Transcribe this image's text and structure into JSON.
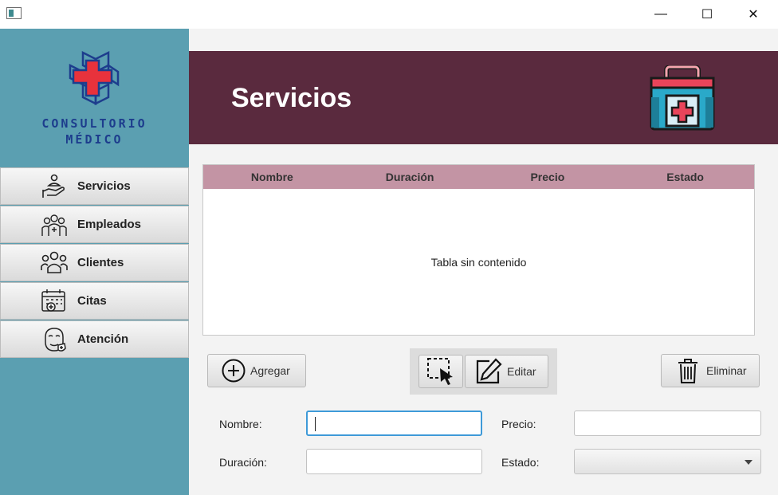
{
  "window": {
    "minimize_glyph": "—",
    "maximize_glyph": "☐",
    "close_glyph": "✕"
  },
  "brand": {
    "line1": "CONSULTORIO",
    "line2": "MÉDICO",
    "logo_icon": "medical-cross-cube-icon"
  },
  "sidebar": {
    "items": [
      {
        "label": "Servicios",
        "icon": "hand-service-icon"
      },
      {
        "label": "Empleados",
        "icon": "staff-group-icon"
      },
      {
        "label": "Clientes",
        "icon": "people-icon"
      },
      {
        "label": "Citas",
        "icon": "calendar-icon"
      },
      {
        "label": "Atención",
        "icon": "face-shield-icon"
      }
    ]
  },
  "header": {
    "title": "Servicios",
    "icon": "first-aid-kit-icon"
  },
  "table": {
    "columns": [
      "Nombre",
      "Duración",
      "Precio",
      "Estado"
    ],
    "rows": [],
    "empty_text": "Tabla sin contenido"
  },
  "actions": {
    "add_label": "Agregar",
    "edit_label": "Editar",
    "delete_label": "Eliminar"
  },
  "form": {
    "nombre_label": "Nombre:",
    "nombre_value": "",
    "duracion_label": "Duración:",
    "duracion_value": "",
    "precio_label": "Precio:",
    "precio_value": "",
    "estado_label": "Estado:",
    "estado_value": ""
  },
  "colors": {
    "sidebar": "#5b9fb1",
    "header": "#5a2a3e",
    "table_header": "#c394a4",
    "brand_text": "#1d3d8d"
  }
}
